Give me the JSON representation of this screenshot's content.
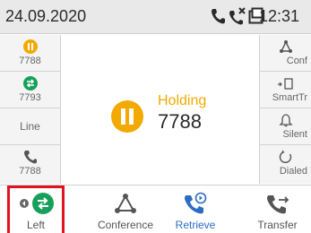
{
  "status": {
    "date": "24.09.2020",
    "time": "12:31"
  },
  "left_keys": [
    {
      "icon": "hold-icon",
      "label": "7788"
    },
    {
      "icon": "transfer-circle-icon",
      "label": "7793"
    },
    {
      "icon": "",
      "label": "Line"
    },
    {
      "icon": "handset-icon",
      "label": "7788"
    }
  ],
  "right_keys": [
    {
      "icon": "conference-icon",
      "label": "Conf"
    },
    {
      "icon": "smart-transfer-icon",
      "label": "SmartTr"
    },
    {
      "icon": "bell-icon",
      "label": "Silent"
    },
    {
      "icon": "redial-icon",
      "label": "Dialed"
    }
  ],
  "call": {
    "state": "Holding",
    "number": "7788"
  },
  "softkeys": [
    {
      "icon": "switch-call-icon",
      "label": "Left"
    },
    {
      "icon": "conference-icon",
      "label": "Conference"
    },
    {
      "icon": "retrieve-icon",
      "label": "Retrieve"
    },
    {
      "icon": "transfer-icon",
      "label": "Transfer"
    }
  ],
  "colors": {
    "hold": "#f2a900",
    "transfer": "#17a05b",
    "active": "#2b6cc4",
    "highlight": "#e0141c"
  }
}
